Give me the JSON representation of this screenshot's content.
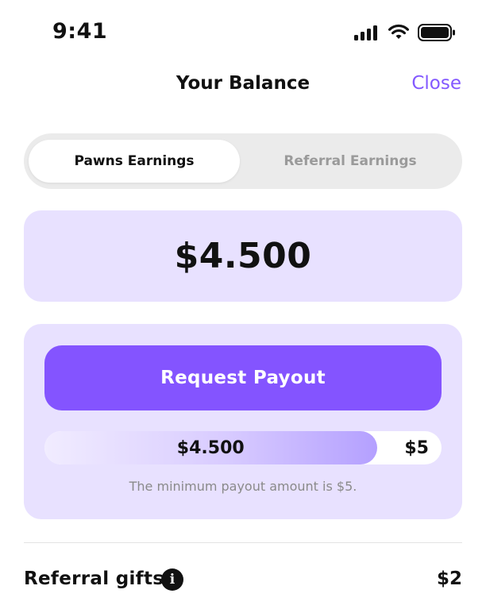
{
  "status_bar": {
    "time": "9:41",
    "icons": [
      "signal-icon",
      "wifi-icon",
      "battery-icon"
    ]
  },
  "header": {
    "title": "Your Balance",
    "close_label": "Close"
  },
  "tabs": [
    {
      "label": "Pawns Earnings",
      "active": true
    },
    {
      "label": "Referral Earnings",
      "active": false
    }
  ],
  "balance": {
    "amount": "$4.500"
  },
  "payout": {
    "button_label": "Request Payout",
    "progress_value_label": "$4.500",
    "progress_target_label": "$5",
    "progress_fraction": 0.9,
    "note": "The minimum payout amount is $5."
  },
  "referral_gifts": {
    "label": "Referral gifts",
    "info_icon": "info-icon",
    "value": "$2"
  },
  "colors": {
    "accent": "#8454ff",
    "close_link": "#8359ff",
    "card_background": "#e8e1ff",
    "segment_background": "#ebebeb",
    "muted_text": "#8a8a8a"
  }
}
